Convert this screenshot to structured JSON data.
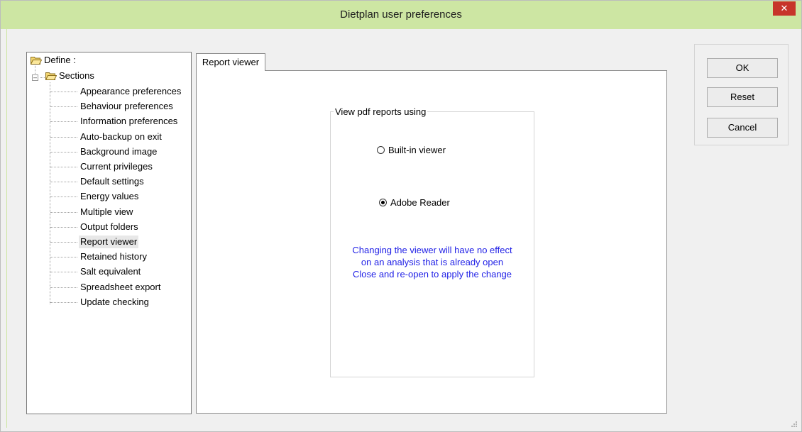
{
  "window": {
    "title": "Dietplan user preferences",
    "close_glyph": "✕"
  },
  "tree": {
    "root_label": "Define :",
    "sections_label": "Sections",
    "expander_glyph": "–",
    "items": [
      "Appearance preferences",
      "Behaviour preferences",
      "Information preferences",
      "Auto-backup on exit",
      "Background image",
      "Current privileges",
      "Default settings",
      "Energy values",
      "Multiple view",
      "Output folders",
      "Report viewer",
      "Retained history",
      "Salt equivalent",
      "Spreadsheet export",
      "Update checking"
    ],
    "selected_index": 10
  },
  "tab": {
    "label": "Report viewer"
  },
  "group": {
    "label": "View pdf reports using",
    "options": [
      {
        "label": "Built-in viewer",
        "selected": false
      },
      {
        "label": "Adobe Reader",
        "selected": true
      }
    ],
    "notice": [
      "Changing the viewer will have no effect",
      "on an analysis that is already open",
      "Close and re-open to apply the change"
    ]
  },
  "buttons": {
    "ok": "OK",
    "reset": "Reset",
    "cancel": "Cancel"
  },
  "colors": {
    "titlebar": "#cde6a3",
    "notice_text": "#1f1fe6",
    "close": "#c7342a"
  }
}
